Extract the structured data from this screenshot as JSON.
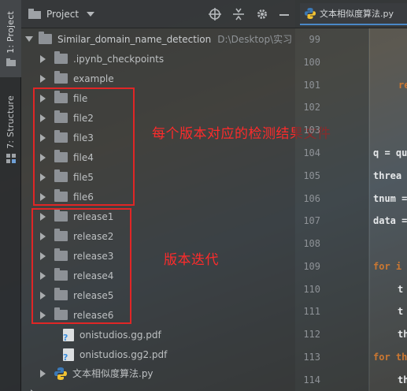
{
  "tool_strip": {
    "project_tab": "1: Project",
    "structure_tab": "7: Structure"
  },
  "panel": {
    "title": "Project"
  },
  "tree": {
    "root": {
      "name": "Similar_domain_name_detection",
      "path": "D:\\Desktop\\实习"
    },
    "items": [
      {
        "label": ".ipynb_checkpoints"
      },
      {
        "label": "example"
      },
      {
        "label": "file"
      },
      {
        "label": "file2"
      },
      {
        "label": "file3"
      },
      {
        "label": "file4"
      },
      {
        "label": "file5"
      },
      {
        "label": "file6"
      },
      {
        "label": "release1"
      },
      {
        "label": "release2"
      },
      {
        "label": "release3"
      },
      {
        "label": "release4"
      },
      {
        "label": "release5"
      },
      {
        "label": "release6"
      },
      {
        "label": "onistudios.gg.pdf"
      },
      {
        "label": "onistudios.gg2.pdf"
      },
      {
        "label": "文本相似度算法.py"
      }
    ]
  },
  "annotations": {
    "files_note": "每个版本对应的检测结果文件",
    "releases_note": "版本迭代",
    "color": "#e02626"
  },
  "editor": {
    "tab_title": "文本相似度算法.py",
    "line_numbers": [
      "99",
      "100",
      "101",
      "102",
      "103",
      "104",
      "105",
      "106",
      "107",
      "108",
      "109",
      "110",
      "111",
      "112",
      "113",
      "114"
    ],
    "code_fragments": [
      {
        "line": "101",
        "text": "re",
        "kind": "keyword"
      },
      {
        "line": "104",
        "text": "q = qu",
        "kind": "text"
      },
      {
        "line": "105",
        "text": "threa",
        "kind": "text"
      },
      {
        "line": "106",
        "text": "tnum =",
        "kind": "text"
      },
      {
        "line": "107",
        "text": "data =",
        "kind": "text"
      },
      {
        "line": "109",
        "text": "for i",
        "kind": "keyword"
      },
      {
        "line": "110",
        "text": "t",
        "kind": "text"
      },
      {
        "line": "111",
        "text": "t",
        "kind": "text"
      },
      {
        "line": "112",
        "text": "th",
        "kind": "text"
      },
      {
        "line": "113",
        "text": "for th",
        "kind": "keyword"
      },
      {
        "line": "114",
        "text": "th",
        "kind": "text"
      }
    ]
  }
}
